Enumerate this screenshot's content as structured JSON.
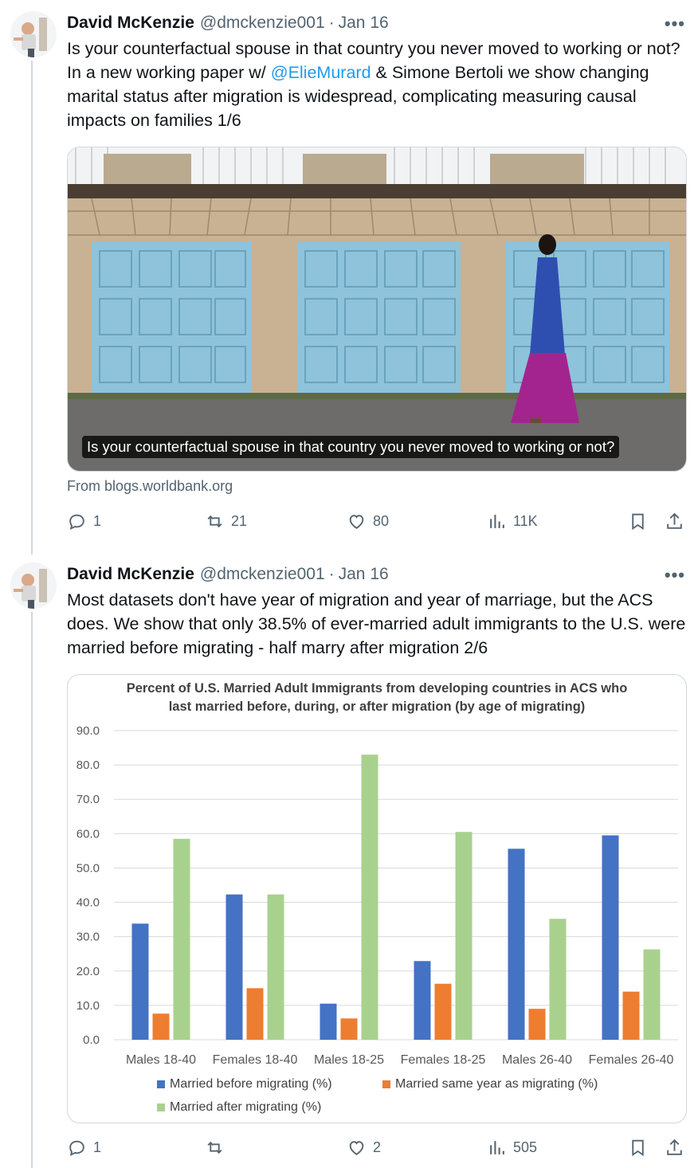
{
  "tweets": [
    {
      "name": "David McKenzie",
      "handle": "@dmckenzie001",
      "date": "Jan 16",
      "text_before": "Is your counterfactual spouse in that country you never moved to working or not? In a new working paper w/ ",
      "mention": "@ElieMurard",
      "text_after": " & Simone Bertoli we show changing marital status after migration is widespread, complicating measuring causal impacts on families 1/6",
      "card_caption": "Is your counterfactual spouse in that country you never moved to working or not?",
      "card_source": "From blogs.worldbank.org",
      "replies": "1",
      "reposts": "21",
      "likes": "80",
      "views": "11K"
    },
    {
      "name": "David McKenzie",
      "handle": "@dmckenzie001",
      "date": "Jan 16",
      "text": "Most datasets don't have year of migration and year of marriage, but the ACS does. We show that only 38.5% of ever-married adult immigrants to the U.S. were married before migrating - half marry after migration 2/6",
      "replies": "1",
      "reposts": "",
      "likes": "2",
      "views": "505"
    }
  ],
  "chart_data": {
    "type": "bar",
    "title_line1": "Percent of U.S. Married Adult Immigrants from developing countries in ACS who",
    "title_line2": "last married before, during, or after migration (by age of migrating)",
    "categories": [
      "Males 18-40",
      "Females 18-40",
      "Males 18-25",
      "Females 18-25",
      "Males 26-40",
      "Females 26-40"
    ],
    "series": [
      {
        "name": "Married before migrating (%)",
        "color": "#4472c4",
        "values": [
          33.8,
          42.3,
          10.5,
          22.9,
          55.6,
          59.5
        ]
      },
      {
        "name": "Married same year as migrating (%)",
        "color": "#ed7d31",
        "values": [
          7.6,
          15.0,
          6.2,
          16.3,
          9.0,
          14.0
        ]
      },
      {
        "name": "Married after migrating (%)",
        "color": "#a9d18e",
        "values": [
          58.5,
          42.3,
          83.0,
          60.5,
          35.2,
          26.3
        ]
      }
    ],
    "yticks": [
      "0.0",
      "10.0",
      "20.0",
      "30.0",
      "40.0",
      "50.0",
      "60.0",
      "70.0",
      "80.0",
      "90.0"
    ],
    "ylim": [
      0,
      90
    ],
    "grid": true,
    "legend": "bottom"
  },
  "icons": {
    "more": "more-icon",
    "reply": "reply-icon",
    "repost": "repost-icon",
    "like": "heart-icon",
    "views": "views-icon",
    "bookmark": "bookmark-icon",
    "share": "share-icon"
  },
  "colors": {
    "mention": "#1d9bf0",
    "secondary_text": "#536471",
    "thread_line": "#cfd9de"
  },
  "more_glyph": "•••"
}
